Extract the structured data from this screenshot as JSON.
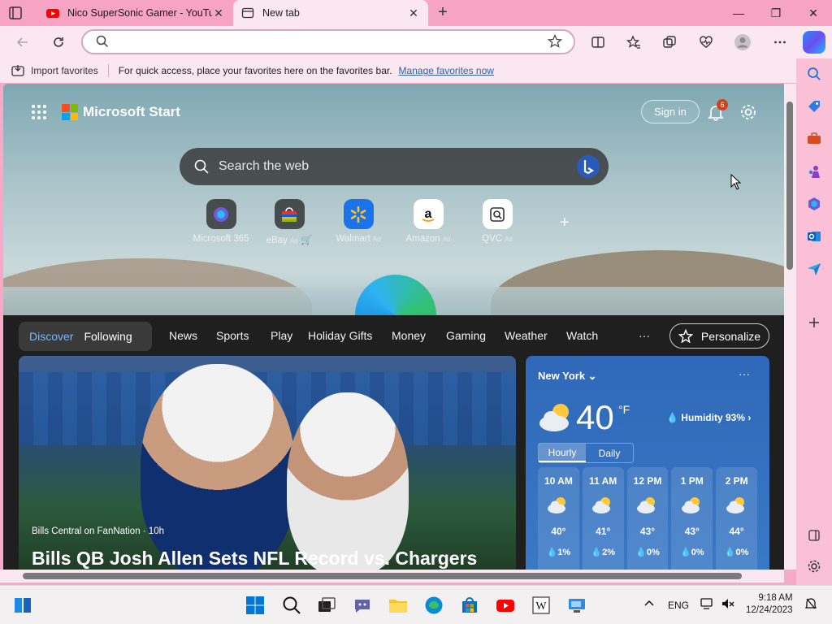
{
  "browser": {
    "tabs": [
      {
        "title": "Nico SuperSonic Gamer - YouTube",
        "close": "✕"
      },
      {
        "title": "New tab",
        "close": "✕"
      }
    ],
    "new_tab_symbol": "+",
    "window_controls": {
      "minimize": "—",
      "restore": "❐",
      "close": "✕"
    },
    "address_value": "",
    "favorites_bar": {
      "import_label": "Import favorites",
      "message": "For quick access, place your favorites here on the favorites bar.",
      "manage_link": "Manage favorites now"
    }
  },
  "ms_start": {
    "brand": "Microsoft Start",
    "sign_in": "Sign in",
    "notification_count": "6",
    "search_placeholder": "Search the web",
    "quick_links": [
      {
        "label": "Microsoft 365",
        "ad": ""
      },
      {
        "label": "eBay",
        "ad": "Ad"
      },
      {
        "label": "Walmart",
        "ad": "Ad"
      },
      {
        "label": "Amazon",
        "ad": "Ad"
      },
      {
        "label": "QVC",
        "ad": "Ad"
      }
    ],
    "add_link_symbol": "+"
  },
  "feed": {
    "toggle": {
      "discover": "Discover",
      "following": "Following"
    },
    "nav": [
      "News",
      "Sports",
      "Play",
      "Holiday Gifts",
      "Money",
      "Gaming",
      "Weather",
      "Watch"
    ],
    "more": "···",
    "personalize": "Personalize",
    "hero": {
      "source": "Bills Central on FanNation · 10h",
      "headline": "Bills QB Josh Allen Sets NFL Record vs. Chargers"
    }
  },
  "weather": {
    "location": "New York",
    "more": "···",
    "temp": "40",
    "unit": "°F",
    "humidity": "Humidity 93%",
    "tabs": {
      "hourly": "Hourly",
      "daily": "Daily"
    },
    "hours": [
      {
        "time": "10 AM",
        "temp": "40°",
        "precip": "1%"
      },
      {
        "time": "11 AM",
        "temp": "41°",
        "precip": "2%"
      },
      {
        "time": "12 PM",
        "temp": "43°",
        "precip": "0%"
      },
      {
        "time": "1 PM",
        "temp": "43°",
        "precip": "0%"
      },
      {
        "time": "2 PM",
        "temp": "44°",
        "precip": "0%"
      }
    ]
  },
  "taskbar": {
    "language": "ENG",
    "time": "9:18 AM",
    "date": "12/24/2023"
  },
  "colors": {
    "browser_frame": "#f6a3c4",
    "toolbar": "#fbe7ef",
    "feed_bg": "#1f1f1f",
    "accent_discover": "#7ab5ff",
    "weather_card": "#3a79c6",
    "badge": "#d2421a"
  }
}
